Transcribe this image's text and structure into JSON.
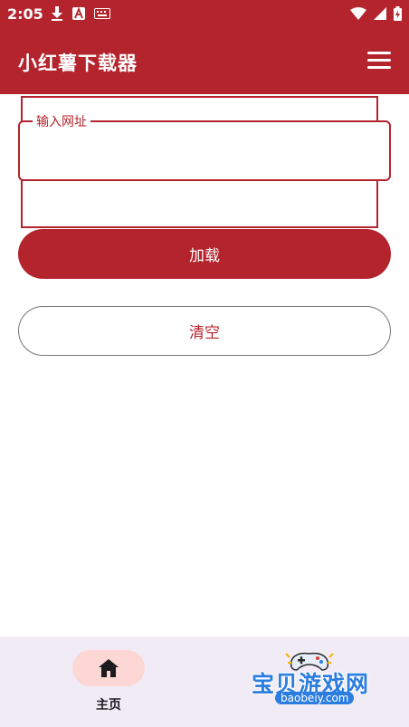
{
  "status_bar": {
    "time": "2:05",
    "left_icons": [
      "download-icon",
      "a-app-icon",
      "keyboard-icon"
    ],
    "right_icons": [
      "wifi-icon",
      "signal-icon",
      "battery-icon"
    ]
  },
  "app_bar": {
    "title": "小红薯下载器",
    "menu_icon": "menu-icon"
  },
  "form": {
    "url_label": "输入网址",
    "url_value": "",
    "load_label": "加载",
    "clear_label": "清空"
  },
  "bottom_nav": {
    "home_label": "主页",
    "home_icon": "home-icon"
  },
  "watermark": {
    "title": "宝贝游戏网",
    "domain": "baobeiy.com"
  },
  "colors": {
    "primary": "#b3242c",
    "nav_background": "#f1ebf5",
    "home_pill": "#fcd7d3"
  }
}
